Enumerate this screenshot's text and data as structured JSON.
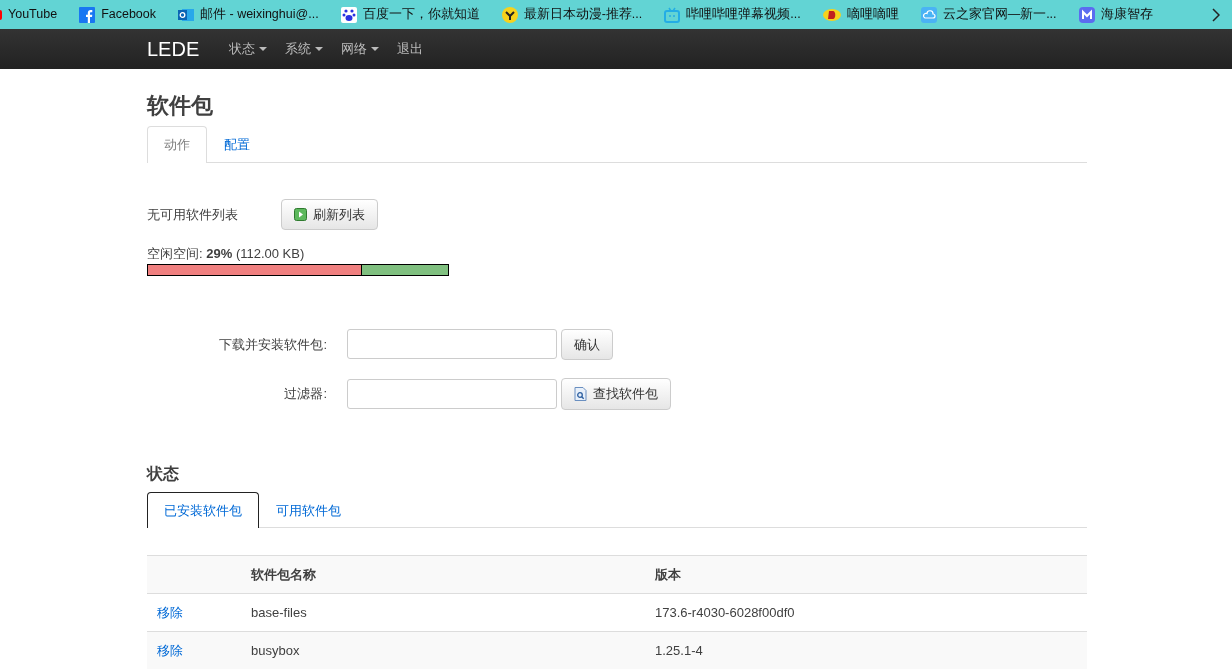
{
  "bookmarks": [
    {
      "label": "YouTube"
    },
    {
      "label": "Facebook"
    },
    {
      "label": "邮件 - weixinghui@..."
    },
    {
      "label": "百度一下，你就知道"
    },
    {
      "label": "最新日本动漫-推荐..."
    },
    {
      "label": "哔哩哔哩弹幕视频..."
    },
    {
      "label": "嘀哩嘀哩"
    },
    {
      "label": "云之家官网—新一..."
    },
    {
      "label": "海康智存"
    }
  ],
  "navbar": {
    "brand": "LEDE",
    "items": [
      {
        "label": "状态",
        "dropdown": true
      },
      {
        "label": "系统",
        "dropdown": true
      },
      {
        "label": "网络",
        "dropdown": true
      },
      {
        "label": "退出",
        "dropdown": false
      }
    ]
  },
  "page_title": "软件包",
  "tabs": [
    {
      "label": "动作",
      "selected": true
    },
    {
      "label": "配置",
      "selected": false
    }
  ],
  "actions": {
    "list_status": "无可用软件列表",
    "refresh_button": "刷新列表",
    "free_space_label": "空闲空间: **29%** (112.00 KB)",
    "free_space": {
      "level": 0.29
    }
  },
  "install": {
    "label": "下载并安装软件包:",
    "button": "确认"
  },
  "filter": {
    "label": "过滤器:",
    "button": "查找软件包"
  },
  "status": {
    "title": "状态",
    "tabs": [
      {
        "label": "已安装软件包",
        "selected": true
      },
      {
        "label": "可用软件包",
        "selected": false
      }
    ],
    "table": {
      "columns": [
        "软件包名称",
        "版本"
      ],
      "rows": [
        {
          "action": "移除",
          "name": "base-files",
          "version": "173.6-r4030-6028f00df0"
        },
        {
          "action": "移除",
          "name": "busybox",
          "version": "1.25.1-4"
        }
      ]
    }
  }
}
